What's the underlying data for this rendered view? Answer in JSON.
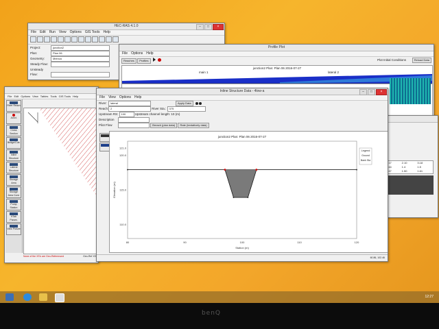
{
  "main_window": {
    "title": "HEC-RAS 4.1.0",
    "menu": [
      "File",
      "Edit",
      "Run",
      "View",
      "Options",
      "GIS Tools",
      "Help"
    ],
    "fields": [
      {
        "label": "Project:",
        "value": "junction2"
      },
      {
        "label": "Plan:",
        "value": "Plan 06"
      },
      {
        "label": "Geometry:",
        "value": "Meinca"
      },
      {
        "label": "Steady Flow:",
        "value": ""
      },
      {
        "label": "Unsteady Flow:",
        "value": ""
      },
      {
        "label": "Description:",
        "value": ""
      }
    ]
  },
  "profile_window": {
    "title": "Profile Plot",
    "menu": [
      "File",
      "Options",
      "Help"
    ],
    "reaches_label": "Reaches",
    "profiles_label": "Profiles",
    "plot_initial_label": "Plot Initial Conditions",
    "reload_label": "Reload Data",
    "plot_title": "junction2    Plan: Plan 06    2016-07-27",
    "left_label": "main 1",
    "right_label": "lateral 2"
  },
  "geometry_window": {
    "menu": [
      "File",
      "Edit",
      "Options",
      "View",
      "Tables",
      "Tools",
      "GIS Tools",
      "Help"
    ],
    "tools": [
      "River Reach",
      "Junct.",
      "Cross Section",
      "Bridge/Culv",
      "Inline Structure",
      "Lateral Structure",
      "Storage Area",
      "Storage Area Conn",
      "Pump Station",
      "HTab Param.",
      "View Picture"
    ],
    "footer_note": "None of the XS's are Geo-Referenced",
    "footer_right": "Geo-Ref XS"
  },
  "inline_window": {
    "title": "Inline Structure Data - 4low-a",
    "menu": [
      "File",
      "View",
      "Options",
      "Help"
    ],
    "river_label": "River:",
    "river_value": "lateral",
    "reach_label": "Reach:",
    "reach_value": "2",
    "river_sta_label": "River Sta.:",
    "river_sta_value": "375",
    "apply_label": "Apply Data",
    "upstream_label": "Upstream RS:",
    "upstream_value": "100",
    "upstream_len_label": "Upstream channel length: 10 (m)",
    "description_label": "Description",
    "pilot_label": "Pilot Flow",
    "breach_label": "Breach (plan data)",
    "rating_label": "Rate (tentatively data)",
    "chart_title": "junction2    Plan: Plan 06    2016-07-27",
    "legend_title": "Legend",
    "legend_items": [
      "Ground",
      "Bank Sta"
    ],
    "status": "60.86, 102.46",
    "colors": {
      "ground": "#7a7a7a",
      "bank": "#d01010",
      "line": "#222222"
    }
  },
  "table_window": {
    "rows": [
      [
        "1.17",
        "2.10",
        "3.18"
      ],
      [
        "1.44",
        "1.4",
        "1.5"
      ],
      [
        "1.47",
        "1.50",
        "1.61"
      ]
    ]
  },
  "taskbar": {
    "clock": "12:27"
  },
  "monitor_brand": "benQ",
  "chart_data": {
    "type": "line",
    "title": "junction2    Plan: Plan 06    2016-07-27",
    "xlabel": "Station (m)",
    "ylabel": "Elevation (m)",
    "xlim": [
      80,
      120
    ],
    "ylim": [
      108,
      122
    ],
    "xticks": [
      "80",
      "90",
      "100",
      "110",
      "120"
    ],
    "yticks": [
      "110.0",
      "115.0",
      "120.0",
      "121.0"
    ],
    "series": [
      {
        "name": "Ground",
        "x": [
          80,
          97,
          98.5,
          101,
          102.5,
          120
        ],
        "y": [
          117.9,
          117.9,
          113.9,
          113.9,
          117.9,
          117.9
        ]
      },
      {
        "name": "Bank Sta",
        "x": [
          97,
          102.5
        ],
        "y": [
          117.9,
          117.9
        ]
      }
    ]
  }
}
